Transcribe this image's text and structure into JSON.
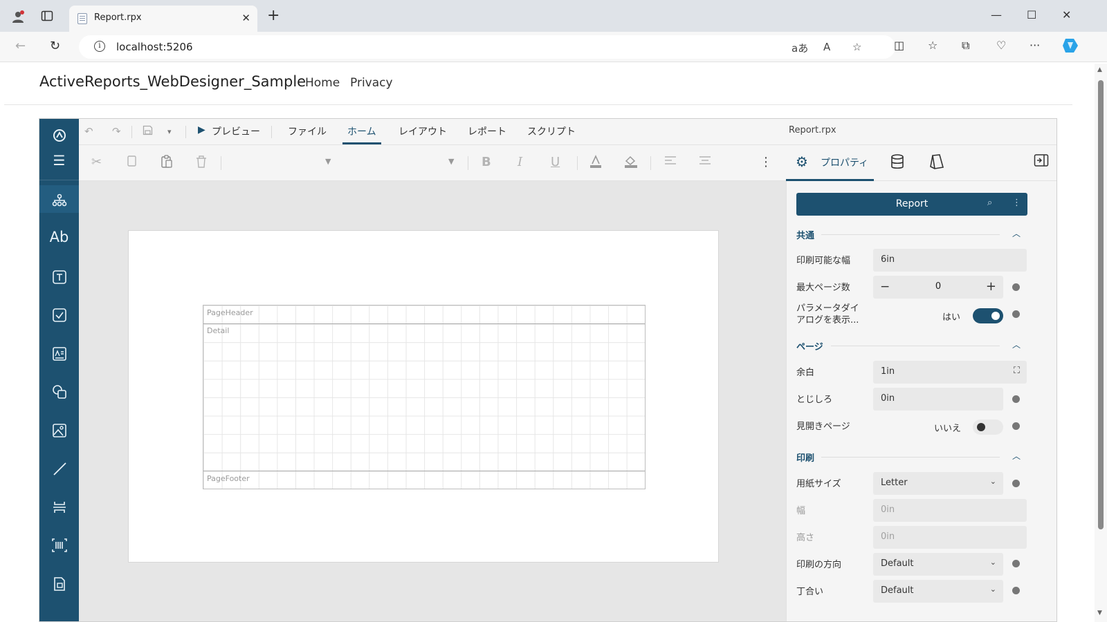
{
  "browser": {
    "tab_title": "Report.rpx",
    "url": "localhost:5206"
  },
  "site": {
    "brand": "ActiveReports_WebDesigner_Sample",
    "nav": [
      "Home",
      "Privacy"
    ]
  },
  "designer": {
    "menu": {
      "preview": "プレビュー",
      "tabs": [
        "ファイル",
        "ホーム",
        "レイアウト",
        "レポート",
        "スクリプト"
      ],
      "active_tab": "ホーム",
      "filename": "Report.rpx"
    },
    "bands": [
      "PageHeader",
      "Detail",
      "PageFooter"
    ],
    "properties": {
      "tab_label": "プロパティ",
      "selected_object": "Report",
      "sections": {
        "common": {
          "title": "共通",
          "printable_width_label": "印刷可能な幅",
          "printable_width": "6in",
          "max_pages_label": "最大ページ数",
          "max_pages": "0",
          "param_dialog_label_1": "パラメータダイ",
          "param_dialog_label_2": "アログを表示...",
          "param_dialog_value": "はい",
          "param_dialog_on": true
        },
        "page": {
          "title": "ページ",
          "margin_label": "余白",
          "margin": "1in",
          "gutter_label": "とじしろ",
          "gutter": "0in",
          "mirror_label": "見開きページ",
          "mirror_value": "いいえ",
          "mirror_on": false
        },
        "print": {
          "title": "印刷",
          "paper_size_label": "用紙サイズ",
          "paper_size": "Letter",
          "width_label": "幅",
          "width": "0in",
          "height_label": "高さ",
          "height": "0in",
          "orientation_label": "印刷の方向",
          "orientation": "Default",
          "collate_label": "丁合い",
          "collate": "Default"
        }
      }
    }
  },
  "colors": {
    "accent": "#1d5170",
    "canvas": "#e6e6e6"
  }
}
